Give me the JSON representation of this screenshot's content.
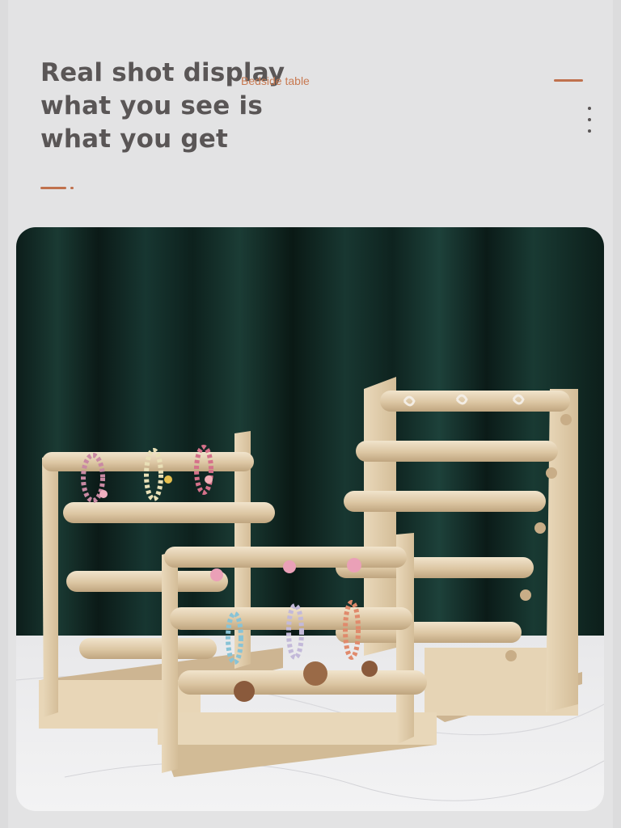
{
  "header": {
    "heading_lines": [
      "Real shot display",
      "what you see is",
      "what you get"
    ],
    "tag": "Bedside table"
  },
  "photo": {
    "subject": "wooden bracelet display stands with hair ties"
  },
  "colors": {
    "accent": "#c0714d",
    "heading": "#5a5656",
    "background": "#e3e3e4",
    "curtain": "#0f2a24",
    "wood": "#e2cfb0"
  },
  "icons": [
    "more-vertical-icon"
  ]
}
